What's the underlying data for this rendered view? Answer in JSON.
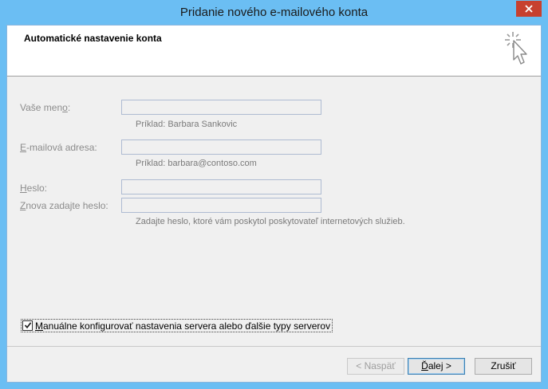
{
  "window": {
    "title": "Pridanie nového e-mailového konta"
  },
  "header": {
    "title": "Automatické nastavenie konta"
  },
  "form": {
    "name": {
      "label_pre": "Vaše men",
      "label_accel": "o",
      "label_post": ":",
      "value": "",
      "hint": "Príklad: Barbara Sankovic"
    },
    "email": {
      "label_pre": "",
      "label_accel": "E",
      "label_post": "-mailová adresa:",
      "value": "",
      "hint": "Príklad: barbara@contoso.com"
    },
    "password": {
      "label_pre": "",
      "label_accel": "H",
      "label_post": "eslo:",
      "value": ""
    },
    "password_confirm": {
      "label_pre": "",
      "label_accel": "Z",
      "label_post": "nova zadajte heslo:",
      "value": "",
      "hint": "Zadajte heslo, ktoré vám poskytol poskytovateľ internetových služieb."
    }
  },
  "manual_config": {
    "checked": true,
    "label_accel": "M",
    "label_post": "anuálne konfigurovať nastavenia servera alebo ďalšie typy serverov"
  },
  "buttons": {
    "back": "< Naspäť",
    "next_accel": "Ď",
    "next_post": "alej >",
    "cancel": "Zrušiť"
  },
  "colors": {
    "titlebar": "#6bbef3",
    "close_button": "#c7402f",
    "header_background": "#ffffff",
    "client_background": "#f0f0f0"
  },
  "icons": {
    "close": "close-icon",
    "wizard": "wizard-cursor-icon",
    "checkmark": "checkmark-icon"
  }
}
